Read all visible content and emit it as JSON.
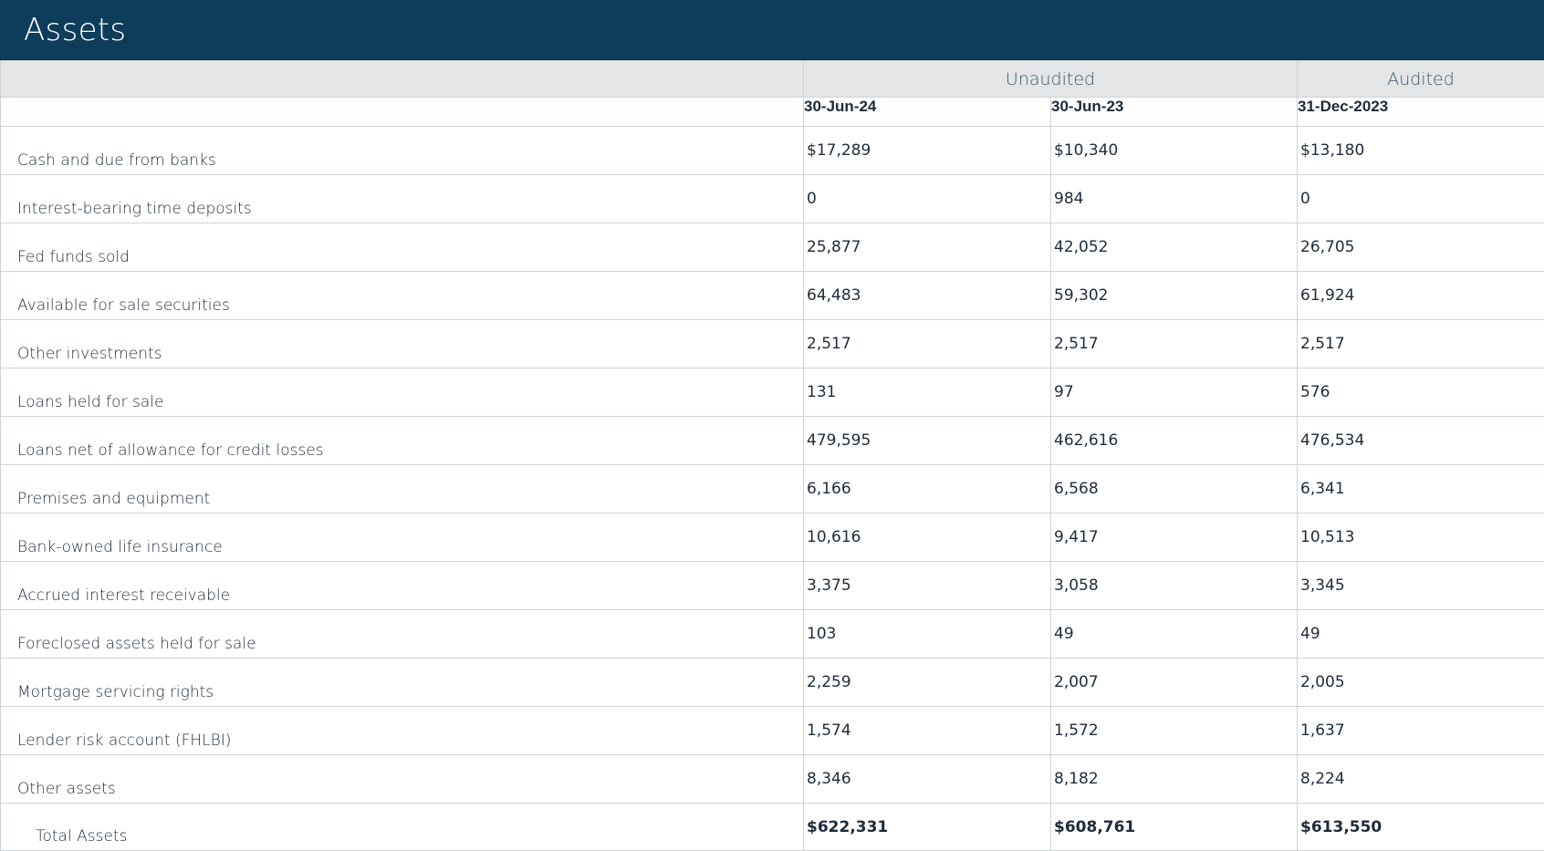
{
  "title": "Assets",
  "groups": {
    "unaudited": "Unaudited",
    "audited": "Audited"
  },
  "dates": [
    "30-Jun-24",
    "30-Jun-23",
    "31-Dec-2023"
  ],
  "rows": [
    {
      "label": "Cash and due from banks",
      "values": [
        "$17,289",
        "$10,340",
        "$13,180"
      ]
    },
    {
      "label": "Interest-bearing time deposits",
      "values": [
        "0",
        "984",
        "0"
      ]
    },
    {
      "label": "Fed funds sold",
      "values": [
        "25,877",
        "42,052",
        "26,705"
      ]
    },
    {
      "label": "Available for sale securities",
      "values": [
        "64,483",
        "59,302",
        "61,924"
      ]
    },
    {
      "label": "Other investments",
      "values": [
        "2,517",
        "2,517",
        "2,517"
      ]
    },
    {
      "label": "Loans held for sale",
      "values": [
        "131",
        "97",
        "576"
      ]
    },
    {
      "label": "Loans net of allowance for credit losses",
      "values": [
        "479,595",
        "462,616",
        "476,534"
      ]
    },
    {
      "label": "Premises and equipment",
      "values": [
        "6,166",
        "6,568",
        "6,341"
      ]
    },
    {
      "label": "Bank-owned life insurance",
      "values": [
        "10,616",
        "9,417",
        "10,513"
      ]
    },
    {
      "label": "Accrued interest receivable",
      "values": [
        "3,375",
        "3,058",
        "3,345"
      ]
    },
    {
      "label": "Foreclosed assets held for sale",
      "values": [
        "103",
        "49",
        "49"
      ]
    },
    {
      "label": "Mortgage servicing rights",
      "values": [
        "2,259",
        "2,007",
        "2,005"
      ]
    },
    {
      "label": "Lender risk account (FHLBI)",
      "values": [
        "1,574",
        "1,572",
        "1,637"
      ]
    },
    {
      "label": "Other assets",
      "values": [
        "8,346",
        "8,182",
        "8,224"
      ]
    }
  ],
  "total": {
    "label": "Total Assets",
    "values": [
      "$622,331",
      "$608,761",
      "$613,550"
    ]
  },
  "colors": {
    "header_bg": "#0e3d5c",
    "band_bg": "#e3e5e7",
    "grid_line": "#cfd3d7"
  }
}
